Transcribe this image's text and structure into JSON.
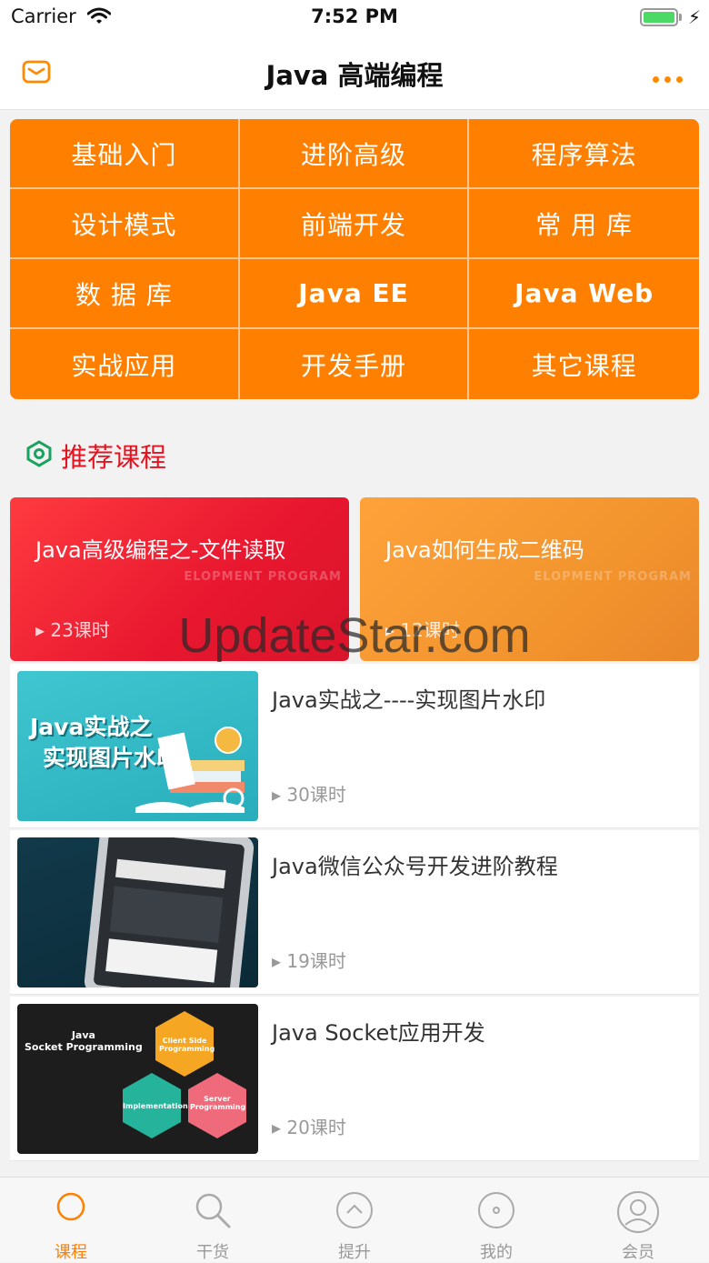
{
  "status_bar": {
    "carrier": "Carrier",
    "time": "7:52 PM"
  },
  "nav": {
    "title": "Java 高端编程"
  },
  "categories": [
    "基础入门",
    "进阶高级",
    "程序算法",
    "设计模式",
    "前端开发",
    "常 用 库",
    "数 据 库",
    "Java  EE",
    "Java  Web",
    "实战应用",
    "开发手册",
    "其它课程"
  ],
  "recommend": {
    "title": "推荐课程",
    "featured": [
      {
        "title": "Java高级编程之-文件读取",
        "lessons": "▸ 23课时",
        "deco": "ELOPMENT PROGRAM"
      },
      {
        "title": "Java如何生成二维码",
        "lessons": "▸ 12课时",
        "deco": "ELOPMENT PROGRAM"
      }
    ],
    "courses": [
      {
        "title": "Java实战之----实现图片水印",
        "lessons": "▸ 30课时",
        "thumb_line1": "Java实战之",
        "thumb_line2": "实现图片水印"
      },
      {
        "title": "Java微信公众号开发进阶教程",
        "lessons": "▸ 19课时"
      },
      {
        "title": "Java Socket应用开发",
        "lessons": "▸ 20课时",
        "thumb_title": "Java\nSocket Programming",
        "hex1": "Client Side Programming",
        "hex2": "Implementation",
        "hex3": "Server Programming"
      }
    ]
  },
  "watermark": "UpdateStar.com",
  "tabs": [
    {
      "label": "课程",
      "icon": "circle-icon"
    },
    {
      "label": "干货",
      "icon": "search-icon"
    },
    {
      "label": "提升",
      "icon": "chevron-up-circle-icon"
    },
    {
      "label": "我的",
      "icon": "dot-circle-icon"
    },
    {
      "label": "会员",
      "icon": "user-icon"
    }
  ],
  "colors": {
    "accent": "#ff7f00",
    "recommend_title": "#e5131f",
    "card_red": "#e8172f",
    "card_orange": "#f3952e"
  }
}
